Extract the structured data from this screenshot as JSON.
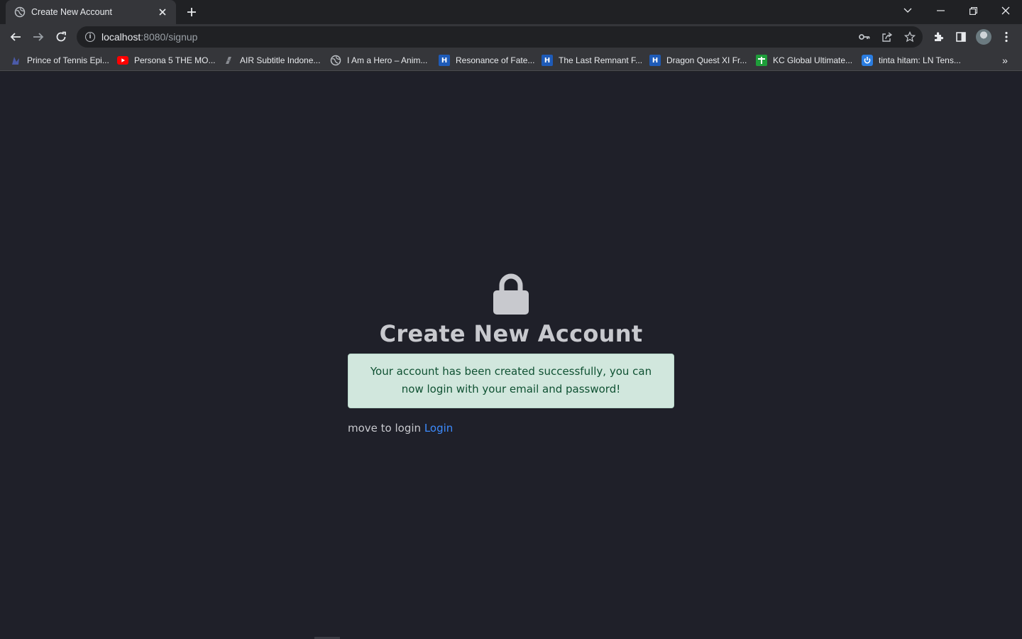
{
  "browser": {
    "tab": {
      "title": "Create New Account"
    },
    "url": {
      "host": "localhost",
      "path": ":8080/signup"
    },
    "bookmarks": [
      {
        "label": "Prince of Tennis Epi...",
        "icon": "prince-of-tennis-icon"
      },
      {
        "label": "Persona 5 THE MO...",
        "icon": "youtube-icon"
      },
      {
        "label": "AIR Subtitle Indone...",
        "icon": "air-subtitle-icon"
      },
      {
        "label": "I Am a Hero – Anim...",
        "icon": "globe-icon"
      },
      {
        "label": "Resonance of Fate...",
        "icon": "h-site-icon"
      },
      {
        "label": "The Last Remnant F...",
        "icon": "h-site-icon"
      },
      {
        "label": "Dragon Quest XI Fr...",
        "icon": "h-site-icon"
      },
      {
        "label": "KC Global Ultimate...",
        "icon": "kc-global-icon"
      },
      {
        "label": "tinta hitam: LN Tens...",
        "icon": "power-icon"
      }
    ]
  },
  "page": {
    "heading": "Create New Account",
    "alert_message": "Your account has been created successfully, you can now login with your email and password!",
    "move_prefix": "move to login",
    "login_link": "Login"
  },
  "colors": {
    "page_bg": "#1f2029",
    "alert_bg": "#d1e7dd",
    "alert_text": "#0f5132",
    "link": "#3d8bfd"
  }
}
